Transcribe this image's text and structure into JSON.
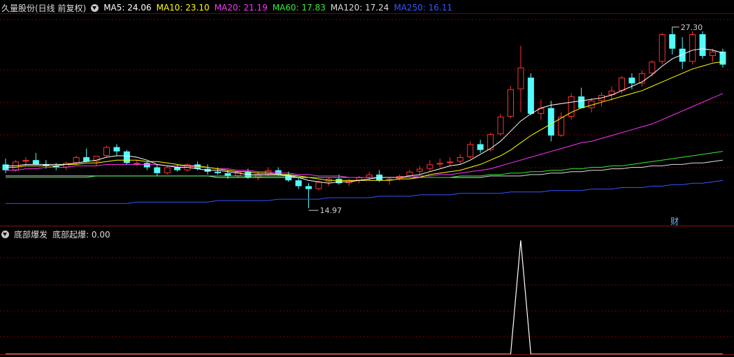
{
  "header": {
    "stock_name": "久量股份(日线 前复权)",
    "ma": [
      {
        "label": "MA5: 24.06",
        "color": "#ffffff"
      },
      {
        "label": "MA10: 23.10",
        "color": "#ffff00"
      },
      {
        "label": "MA20: 21.19",
        "color": "#ff33ff"
      },
      {
        "label": "MA60: 17.83",
        "color": "#33ee33"
      },
      {
        "label": "MA120: 17.24",
        "color": "#dddddd"
      },
      {
        "label": "MA250: 16.11",
        "color": "#3355ff"
      }
    ]
  },
  "annotations": {
    "high": "27.30",
    "low": "14.97",
    "cai": "财"
  },
  "sub_header": {
    "indicator": "底部爆发",
    "value": "底部起爆: 0.00"
  },
  "colors": {
    "up": "#ff3232",
    "down": "#54fcfc",
    "grid": "#7a0000",
    "signal": "#ffffff"
  },
  "chart_data": [
    {
      "type": "candlestick",
      "ylim": [
        14.3,
        28.4
      ],
      "candles": [
        [
          18.0,
          18.4,
          17.4,
          17.6
        ],
        [
          17.6,
          18.3,
          17.5,
          18.2
        ],
        [
          18.2,
          18.5,
          17.9,
          18.3
        ],
        [
          18.3,
          18.8,
          18.1,
          18.0
        ],
        [
          18.0,
          18.3,
          17.7,
          17.9
        ],
        [
          17.9,
          18.1,
          17.6,
          17.8
        ],
        [
          17.8,
          18.2,
          17.6,
          18.1
        ],
        [
          18.1,
          18.6,
          18.0,
          18.5
        ],
        [
          18.5,
          19.1,
          18.4,
          18.2
        ],
        [
          18.2,
          18.5,
          17.9,
          18.6
        ],
        [
          18.6,
          19.3,
          18.5,
          19.2
        ],
        [
          19.2,
          19.4,
          18.6,
          18.9
        ],
        [
          18.9,
          19.0,
          18.0,
          18.1
        ],
        [
          18.1,
          18.3,
          17.9,
          18.1
        ],
        [
          18.1,
          18.2,
          17.6,
          17.8
        ],
        [
          17.8,
          18.0,
          17.2,
          17.4
        ],
        [
          17.4,
          17.9,
          17.3,
          17.8
        ],
        [
          17.8,
          18.0,
          17.5,
          17.6
        ],
        [
          17.6,
          18.1,
          17.5,
          18.0
        ],
        [
          18.0,
          18.2,
          17.6,
          17.7
        ],
        [
          17.7,
          18.0,
          17.3,
          17.5
        ],
        [
          17.5,
          17.8,
          17.3,
          17.4
        ],
        [
          17.4,
          17.6,
          17.0,
          17.2
        ],
        [
          17.2,
          17.6,
          17.1,
          17.5
        ],
        [
          17.5,
          17.7,
          17.0,
          17.1
        ],
        [
          17.1,
          17.5,
          16.9,
          17.3
        ],
        [
          17.3,
          17.8,
          17.2,
          17.6
        ],
        [
          17.6,
          17.8,
          17.2,
          17.3
        ],
        [
          17.3,
          17.5,
          16.8,
          16.9
        ],
        [
          16.9,
          17.1,
          16.3,
          16.5
        ],
        [
          16.5,
          16.7,
          14.97,
          16.3
        ],
        [
          16.3,
          16.9,
          16.2,
          16.8
        ],
        [
          16.8,
          17.1,
          16.5,
          17.0
        ],
        [
          17.0,
          17.3,
          16.6,
          16.7
        ],
        [
          16.7,
          17.0,
          16.5,
          16.9
        ],
        [
          16.9,
          17.2,
          16.7,
          17.1
        ],
        [
          17.1,
          17.5,
          16.9,
          17.3
        ],
        [
          17.3,
          17.6,
          16.8,
          16.9
        ],
        [
          16.9,
          17.1,
          16.6,
          17.0
        ],
        [
          17.0,
          17.3,
          16.9,
          17.2
        ],
        [
          17.2,
          17.6,
          17.1,
          17.5
        ],
        [
          17.5,
          17.9,
          17.3,
          17.7
        ],
        [
          17.7,
          18.3,
          17.5,
          18.0
        ],
        [
          18.0,
          18.4,
          17.8,
          18.1
        ],
        [
          18.1,
          18.5,
          17.9,
          18.2
        ],
        [
          18.2,
          18.7,
          18.0,
          18.5
        ],
        [
          18.5,
          19.6,
          18.4,
          19.4
        ],
        [
          19.4,
          19.7,
          18.8,
          19.0
        ],
        [
          19.0,
          20.2,
          18.9,
          20.1
        ],
        [
          20.1,
          21.5,
          20.0,
          21.3
        ],
        [
          21.3,
          23.4,
          21.2,
          23.2
        ],
        [
          23.2,
          26.2,
          21.6,
          24.7
        ],
        [
          24.0,
          24.3,
          21.4,
          21.5
        ],
        [
          21.5,
          22.5,
          21.1,
          21.9
        ],
        [
          21.9,
          22.4,
          19.6,
          20.0
        ],
        [
          20.0,
          21.6,
          19.9,
          21.3
        ],
        [
          21.3,
          22.9,
          21.1,
          22.7
        ],
        [
          22.7,
          23.3,
          22.1,
          21.9
        ],
        [
          21.9,
          22.6,
          21.6,
          22.4
        ],
        [
          22.4,
          23.0,
          22.0,
          22.8
        ],
        [
          22.8,
          23.4,
          22.4,
          23.1
        ],
        [
          23.1,
          24.1,
          22.9,
          24.0
        ],
        [
          24.0,
          24.3,
          23.2,
          23.6
        ],
        [
          23.6,
          24.5,
          23.4,
          24.3
        ],
        [
          24.3,
          25.2,
          24.1,
          25.1
        ],
        [
          25.1,
          27.1,
          24.9,
          27.0
        ],
        [
          27.0,
          27.3,
          25.6,
          26.0
        ],
        [
          26.0,
          26.8,
          24.6,
          25.1
        ],
        [
          25.1,
          27.2,
          24.9,
          27.0
        ],
        [
          27.0,
          27.2,
          25.3,
          25.5
        ],
        [
          25.5,
          26.0,
          25.1,
          25.8
        ],
        [
          25.8,
          26.0,
          24.7,
          24.9
        ]
      ],
      "ma5": [
        17.9,
        17.9,
        18.0,
        18.0,
        18.0,
        18.0,
        18.0,
        18.1,
        18.2,
        18.3,
        18.5,
        18.6,
        18.6,
        18.5,
        18.3,
        18.0,
        17.9,
        17.8,
        17.8,
        17.7,
        17.6,
        17.6,
        17.5,
        17.4,
        17.3,
        17.3,
        17.3,
        17.3,
        17.2,
        17.1,
        16.9,
        16.8,
        16.7,
        16.8,
        16.8,
        16.9,
        17.0,
        17.1,
        17.1,
        17.1,
        17.2,
        17.3,
        17.5,
        17.7,
        17.9,
        18.0,
        18.3,
        18.7,
        19.1,
        19.6,
        20.3,
        21.0,
        21.5,
        21.9,
        22.1,
        22.2,
        22.3,
        22.4,
        22.5,
        22.6,
        22.8,
        23.1,
        23.4,
        23.7,
        24.2,
        24.8,
        25.3,
        25.6,
        25.9,
        26.0,
        25.9,
        25.7
      ],
      "ma10": [
        17.8,
        17.8,
        17.9,
        17.9,
        17.9,
        17.9,
        18.0,
        18.0,
        18.1,
        18.1,
        18.2,
        18.3,
        18.3,
        18.3,
        18.2,
        18.2,
        18.1,
        18.0,
        17.9,
        17.9,
        17.8,
        17.7,
        17.6,
        17.5,
        17.5,
        17.4,
        17.4,
        17.3,
        17.3,
        17.2,
        17.1,
        17.0,
        16.9,
        16.9,
        16.9,
        16.9,
        16.9,
        16.9,
        16.9,
        17.0,
        17.0,
        17.1,
        17.3,
        17.4,
        17.5,
        17.6,
        17.8,
        18.0,
        18.3,
        18.6,
        19.0,
        19.5,
        20.0,
        20.4,
        20.8,
        21.2,
        21.6,
        21.9,
        22.1,
        22.3,
        22.5,
        22.7,
        22.9,
        23.1,
        23.4,
        23.7,
        24.0,
        24.3,
        24.6,
        24.8,
        25.0,
        25.1
      ],
      "ma20": [
        17.6,
        17.6,
        17.7,
        17.7,
        17.8,
        17.8,
        17.8,
        17.9,
        17.9,
        17.9,
        18.0,
        18.0,
        18.0,
        18.0,
        18.0,
        18.0,
        17.9,
        17.9,
        17.9,
        17.8,
        17.8,
        17.7,
        17.7,
        17.6,
        17.6,
        17.5,
        17.5,
        17.4,
        17.4,
        17.3,
        17.3,
        17.2,
        17.2,
        17.2,
        17.1,
        17.1,
        17.1,
        17.1,
        17.1,
        17.1,
        17.1,
        17.2,
        17.2,
        17.3,
        17.3,
        17.4,
        17.5,
        17.6,
        17.7,
        17.9,
        18.1,
        18.3,
        18.5,
        18.7,
        18.9,
        19.1,
        19.3,
        19.5,
        19.6,
        19.8,
        20.0,
        20.2,
        20.4,
        20.6,
        20.8,
        21.1,
        21.4,
        21.7,
        22.0,
        22.3,
        22.6,
        22.9
      ],
      "ma60": [
        17.1,
        17.1,
        17.1,
        17.1,
        17.1,
        17.1,
        17.1,
        17.1,
        17.1,
        17.2,
        17.2,
        17.2,
        17.2,
        17.2,
        17.2,
        17.2,
        17.2,
        17.2,
        17.2,
        17.2,
        17.2,
        17.2,
        17.2,
        17.2,
        17.2,
        17.2,
        17.2,
        17.2,
        17.2,
        17.2,
        17.1,
        17.1,
        17.1,
        17.1,
        17.1,
        17.1,
        17.1,
        17.1,
        17.1,
        17.1,
        17.1,
        17.1,
        17.1,
        17.1,
        17.1,
        17.2,
        17.2,
        17.2,
        17.3,
        17.3,
        17.4,
        17.4,
        17.5,
        17.5,
        17.6,
        17.6,
        17.7,
        17.7,
        17.8,
        17.8,
        17.9,
        17.9,
        18.0,
        18.1,
        18.2,
        18.3,
        18.4,
        18.5,
        18.6,
        18.7,
        18.8,
        18.9
      ],
      "ma120": [
        17.2,
        17.2,
        17.2,
        17.2,
        17.2,
        17.2,
        17.2,
        17.2,
        17.2,
        17.2,
        17.2,
        17.2,
        17.2,
        17.2,
        17.2,
        17.2,
        17.2,
        17.2,
        17.2,
        17.2,
        17.2,
        17.1,
        17.1,
        17.1,
        17.1,
        17.1,
        17.1,
        17.1,
        17.1,
        17.1,
        17.1,
        17.1,
        17.1,
        17.1,
        17.1,
        17.1,
        17.1,
        17.1,
        17.1,
        17.1,
        17.1,
        17.1,
        17.1,
        17.1,
        17.1,
        17.1,
        17.1,
        17.1,
        17.2,
        17.2,
        17.2,
        17.2,
        17.3,
        17.3,
        17.4,
        17.4,
        17.5,
        17.5,
        17.6,
        17.6,
        17.7,
        17.7,
        17.8,
        17.8,
        17.9,
        17.9,
        18.0,
        18.0,
        18.1,
        18.1,
        18.2,
        18.3
      ],
      "ma250": [
        15.3,
        15.3,
        15.3,
        15.3,
        15.3,
        15.3,
        15.3,
        15.3,
        15.3,
        15.3,
        15.3,
        15.3,
        15.3,
        15.4,
        15.4,
        15.4,
        15.4,
        15.4,
        15.4,
        15.4,
        15.4,
        15.5,
        15.5,
        15.5,
        15.5,
        15.5,
        15.5,
        15.6,
        15.6,
        15.6,
        15.6,
        15.6,
        15.7,
        15.7,
        15.7,
        15.7,
        15.7,
        15.8,
        15.8,
        15.8,
        15.8,
        15.9,
        15.9,
        15.9,
        15.9,
        16.0,
        16.0,
        16.0,
        16.0,
        16.0,
        16.1,
        16.1,
        16.1,
        16.1,
        16.2,
        16.2,
        16.2,
        16.2,
        16.3,
        16.3,
        16.3,
        16.4,
        16.4,
        16.4,
        16.5,
        16.5,
        16.6,
        16.6,
        16.7,
        16.7,
        16.8,
        16.9
      ]
    },
    {
      "type": "line",
      "name": "底部起爆",
      "ylim": [
        0,
        1
      ],
      "signal_index": 51,
      "signal_value": 1
    }
  ]
}
